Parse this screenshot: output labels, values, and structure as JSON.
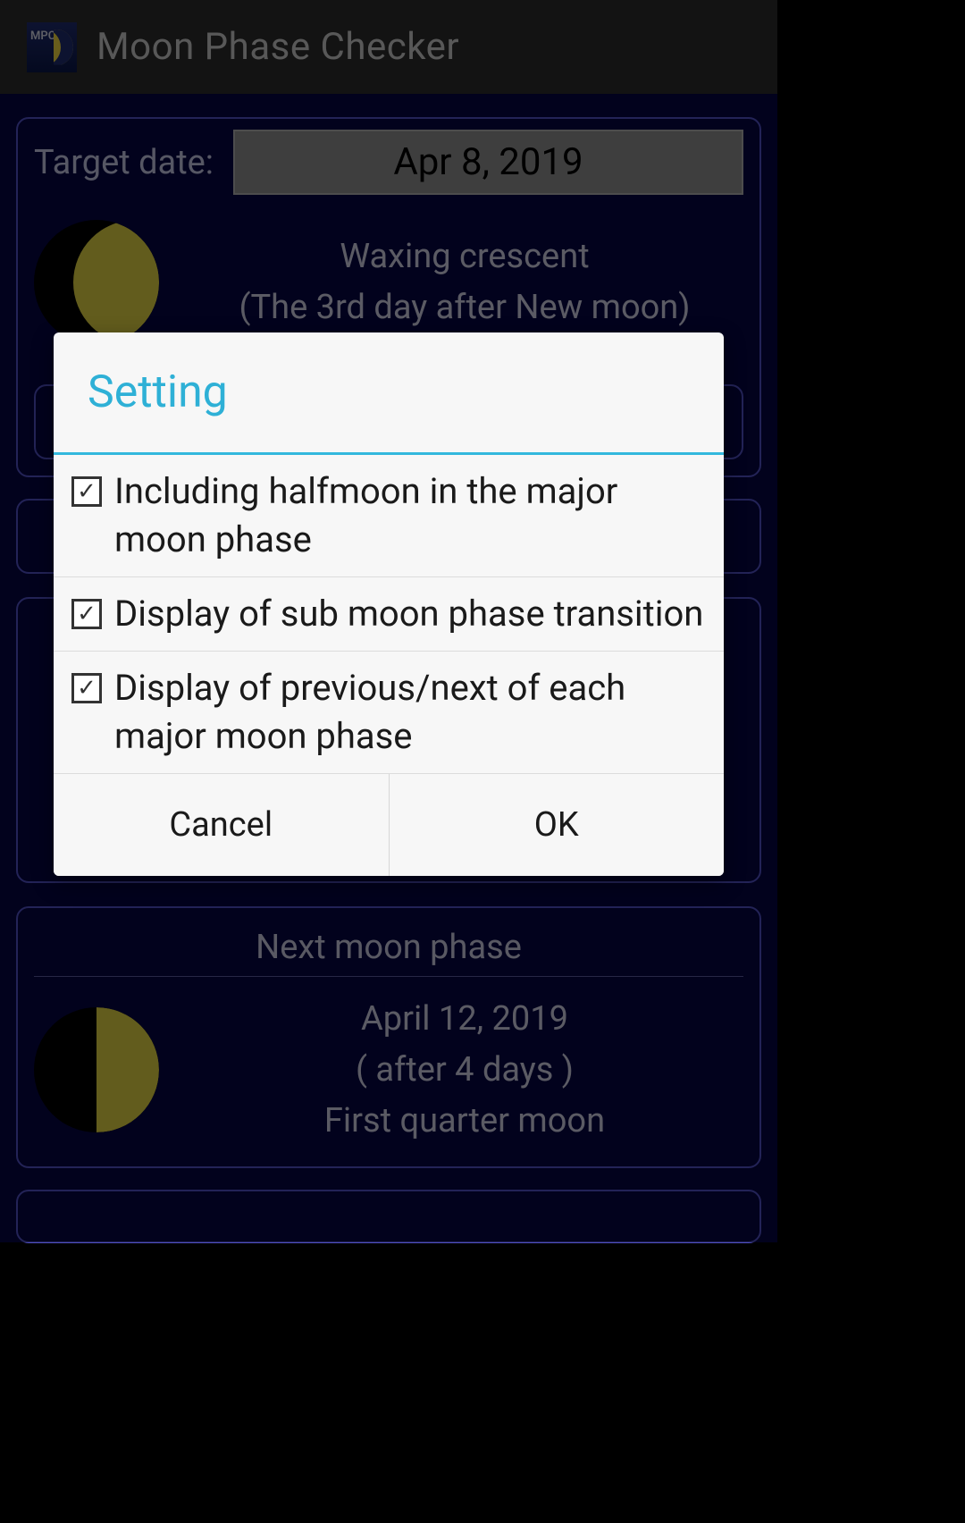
{
  "header": {
    "app_title": "Moon Phase Checker",
    "app_icon_badge": "MPC"
  },
  "target": {
    "label": "Target date:",
    "date": "Apr 8, 2019",
    "phase_line1": "Waxing crescent",
    "phase_line2": "(The 3rd day after New moon)"
  },
  "next": {
    "title": "Next moon phase",
    "date": "April 12, 2019",
    "offset": "( after 4 days )",
    "phase": "First quarter moon"
  },
  "dialog": {
    "title": "Setting",
    "options": [
      {
        "label": "Including halfmoon in the major moon phase",
        "checked": true
      },
      {
        "label": "Display of sub moon phase transition",
        "checked": true
      },
      {
        "label": "Display of previous/next of each major moon phase",
        "checked": true
      }
    ],
    "cancel": "Cancel",
    "ok": "OK"
  }
}
